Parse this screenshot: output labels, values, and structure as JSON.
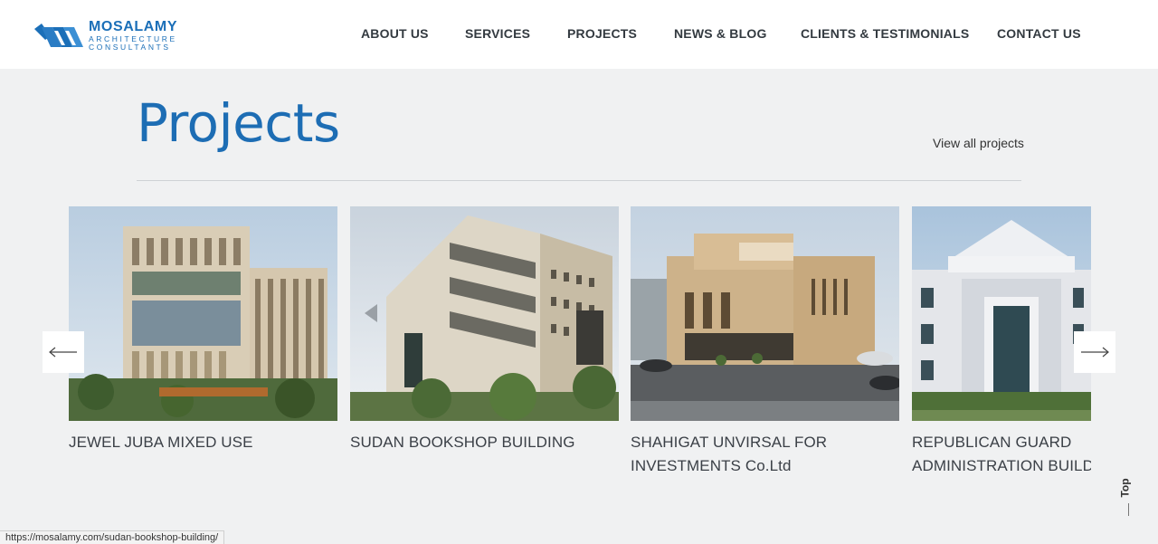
{
  "brand": {
    "name": "MOSALAMY",
    "sub_line1": "ARCHITECTURE",
    "sub_line2": "CONSULTANTS",
    "color": "#1b6fb8"
  },
  "nav": {
    "items": [
      {
        "label": "ABOUT US"
      },
      {
        "label": "SERVICES"
      },
      {
        "label": "PROJECTS"
      },
      {
        "label": "NEWS & BLOG"
      },
      {
        "label": "CLIENTS & TESTIMONIALS"
      },
      {
        "label": "CONTACT US"
      }
    ]
  },
  "section": {
    "title": "Projects",
    "view_all": "View all projects",
    "title_color": "#1d6db4"
  },
  "projects": [
    {
      "title": "JEWEL JUBA MIXED USE",
      "image": "mixed-use-tower-render"
    },
    {
      "title": "SUDAN BOOKSHOP BUILDING",
      "image": "bookshop-building-render"
    },
    {
      "title_line1": "SHAHIGAT UNVIRSAL FOR",
      "title_line2": "INVESTMENTS Co.Ltd",
      "image": "investments-building-render"
    },
    {
      "title_line1": "REPUBLICAN GUARD",
      "title_line2": "ADMINISTRATION BUILDIN",
      "image": "classical-administration-building-render"
    }
  ],
  "carousel": {
    "prev_icon": "arrow-left-icon",
    "next_icon": "arrow-right-icon"
  },
  "status_url": "https://mosalamy.com/sudan-bookshop-building/",
  "back_to_top": "Top"
}
